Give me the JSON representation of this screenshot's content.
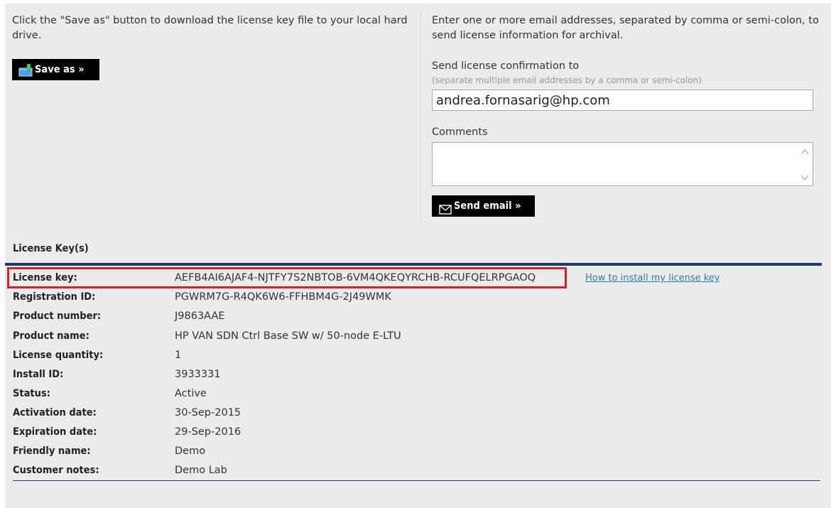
{
  "save_section": {
    "instructions": "Click the \"Save as\" button to download the license key file to your local hard drive.",
    "save_button_label": "Save as »"
  },
  "email_section": {
    "instructions": "Enter one or more email addresses, separated by comma or semi-colon, to send license information for archival.",
    "confirmation_label": "Send license confirmation to",
    "confirmation_hint": "(separate multiple email addresses by a comma or semi-colon)",
    "email_value": "andrea.fornasarig@hp.com",
    "comments_label": "Comments",
    "comments_value": "",
    "send_button_label": "Send email »"
  },
  "license_section": {
    "title": "License Key(s)",
    "install_link": "How to install my license key",
    "rows": [
      {
        "label": "License key:",
        "value": "AEFB4AI6AJAF4-NJTFY7S2NBTOB-6VM4QKEQYRCHB-RCUFQELRPGAOQ"
      },
      {
        "label": "Registration ID:",
        "value": "PGWRM7G-R4QK6W6-FFHBM4G-2J49WMK"
      },
      {
        "label": "Product number:",
        "value": "J9863AAE"
      },
      {
        "label": "Product name:",
        "value": "HP VAN SDN Ctrl Base SW w/ 50-node E-LTU"
      },
      {
        "label": "License quantity:",
        "value": "1"
      },
      {
        "label": "Install ID:",
        "value": "3933331"
      },
      {
        "label": "Status:",
        "value": "Active"
      },
      {
        "label": "Activation date:",
        "value": "30-Sep-2015"
      },
      {
        "label": "Expiration date:",
        "value": "29-Sep-2016"
      },
      {
        "label": "Friendly name:",
        "value": "Demo"
      },
      {
        "label": "Customer notes:",
        "value": "Demo Lab"
      }
    ]
  },
  "colors": {
    "highlight": "#d2232a",
    "rule": "#1e3a6e",
    "link": "#2a7ab8"
  }
}
